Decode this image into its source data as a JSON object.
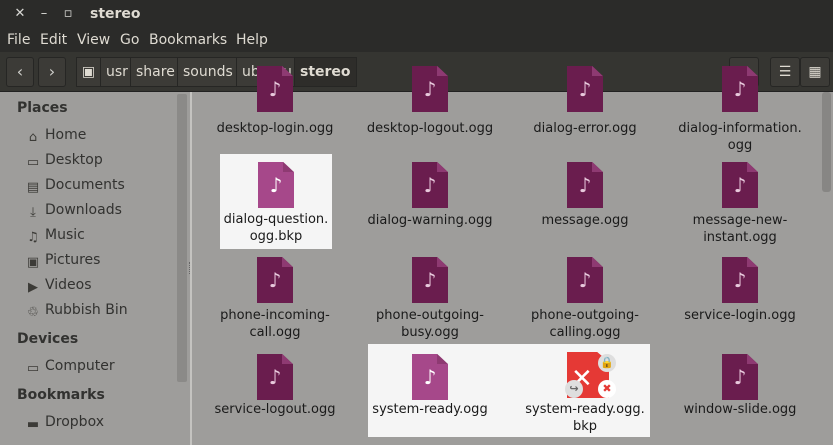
{
  "window": {
    "title": "stereo"
  },
  "menu": [
    "File",
    "Edit",
    "View",
    "Go",
    "Bookmarks",
    "Help"
  ],
  "breadcrumb": [
    "usr",
    "share",
    "sounds",
    "ubuntu",
    "stereo"
  ],
  "sidebar": {
    "places_header": "Places",
    "places": [
      {
        "label": "Home",
        "icon": "home-icon"
      },
      {
        "label": "Desktop",
        "icon": "desktop-icon"
      },
      {
        "label": "Documents",
        "icon": "documents-icon"
      },
      {
        "label": "Downloads",
        "icon": "downloads-icon"
      },
      {
        "label": "Music",
        "icon": "music-icon"
      },
      {
        "label": "Pictures",
        "icon": "pictures-icon"
      },
      {
        "label": "Videos",
        "icon": "videos-icon"
      },
      {
        "label": "Rubbish Bin",
        "icon": "trash-icon"
      }
    ],
    "devices_header": "Devices",
    "devices": [
      {
        "label": "Computer",
        "icon": "computer-icon"
      }
    ],
    "bookmarks_header": "Bookmarks",
    "bookmarks": [
      {
        "label": "Dropbox",
        "icon": "folder-icon"
      }
    ]
  },
  "files": [
    {
      "line1": "desktop-login.ogg",
      "line2": ""
    },
    {
      "line1": "desktop-logout.ogg",
      "line2": ""
    },
    {
      "line1": "dialog-error.ogg",
      "line2": ""
    },
    {
      "line1": "dialog-information.",
      "line2": "ogg"
    },
    {
      "line1": "dialog-question.",
      "line2": "ogg.bkp"
    },
    {
      "line1": "dialog-warning.ogg",
      "line2": ""
    },
    {
      "line1": "message.ogg",
      "line2": ""
    },
    {
      "line1": "message-new-",
      "line2": "instant.ogg"
    },
    {
      "line1": "phone-incoming-",
      "line2": "call.ogg"
    },
    {
      "line1": "phone-outgoing-",
      "line2": "busy.ogg"
    },
    {
      "line1": "phone-outgoing-",
      "line2": "calling.ogg"
    },
    {
      "line1": "service-login.ogg",
      "line2": ""
    },
    {
      "line1": "service-logout.ogg",
      "line2": ""
    },
    {
      "line1": "system-ready.ogg",
      "line2": ""
    },
    {
      "line1": "system-ready.ogg.",
      "line2": "bkp"
    },
    {
      "line1": "window-slide.ogg",
      "line2": ""
    }
  ],
  "colors": {
    "selection": "#f5f5f5",
    "audio_icon": "#6a1d4e",
    "broken_icon": "#e53935"
  }
}
